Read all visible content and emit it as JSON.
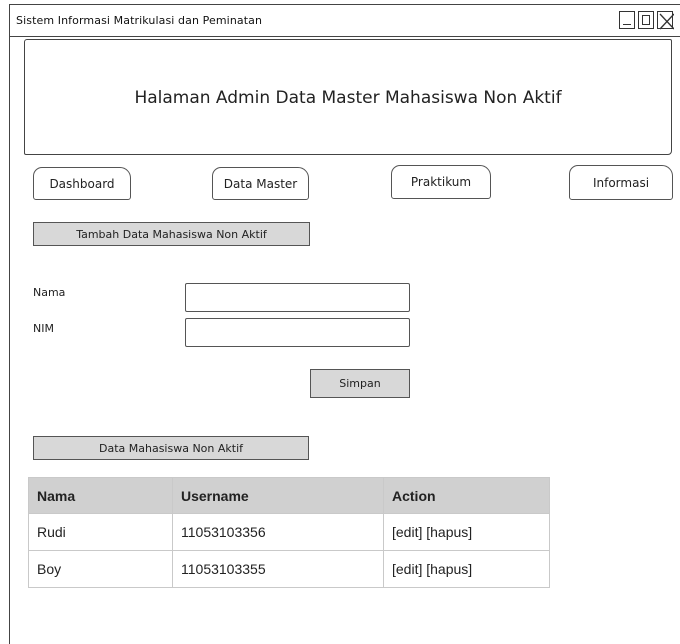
{
  "window": {
    "title": "Sistem Informasi Matrikulasi dan Peminatan"
  },
  "header": {
    "title": "Halaman Admin Data Master Mahasiswa Non Aktif"
  },
  "nav": {
    "items": [
      {
        "label": "Dashboard"
      },
      {
        "label": "Data Master"
      },
      {
        "label": "Praktikum"
      },
      {
        "label": "Informasi"
      }
    ]
  },
  "form": {
    "section_label": "Tambah Data Mahasiswa Non Aktif",
    "nama_label": "Nama",
    "nama_value": "",
    "nim_label": "NIM",
    "nim_value": "",
    "submit_label": "Simpan"
  },
  "list": {
    "section_label": "Data Mahasiswa Non Aktif",
    "columns": [
      "Nama",
      "Username",
      "Action"
    ],
    "rows": [
      {
        "nama": "Rudi",
        "username": "11053103356",
        "action": "[edit] [hapus]"
      },
      {
        "nama": "Boy",
        "username": "11053103355",
        "action": "[edit] [hapus]"
      }
    ]
  },
  "colors": {
    "border": "#444444",
    "button_fill": "#d8d8d8",
    "table_header": "#d0d0d0"
  }
}
